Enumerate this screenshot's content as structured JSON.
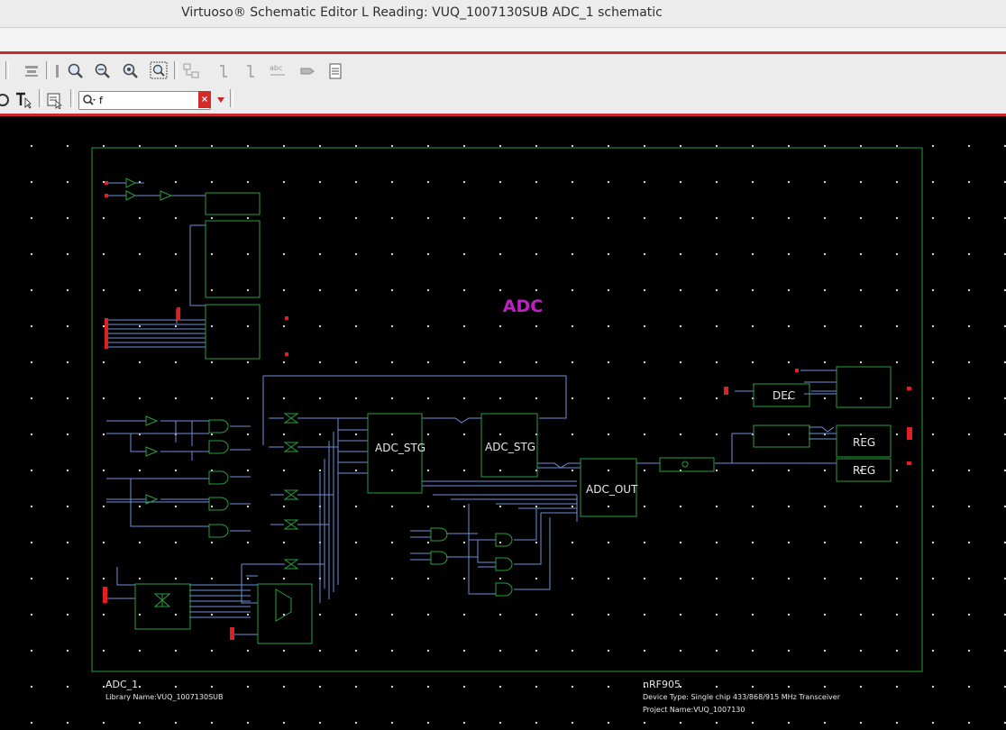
{
  "window": {
    "title": "Virtuoso® Schematic Editor L Reading: VUQ_1007130SUB ADC_1 schematic"
  },
  "toolbar": {
    "icons": [
      "align-icon",
      "distribute-icon",
      "zoom-fit-icon",
      "zoom-in-icon",
      "zoom-out-icon",
      "zoom-box-icon",
      "hierarchy-icon",
      "descend-icon",
      "return-icon",
      "label-icon",
      "pin-icon",
      "sheet-icon"
    ]
  },
  "search": {
    "value": "f",
    "clear_label": "×"
  },
  "schematic": {
    "title_label": "ADC",
    "colors": {
      "wire": "#6f8fd8",
      "outline": "#28a03c",
      "pin": "#e02020",
      "title": "#c21ec8",
      "text": "#e8e8e8"
    },
    "blocks": {
      "adc_stg_1": "ADC_STG",
      "adc_stg_2": "ADC_STG",
      "adc_out": "ADC_OUT",
      "dec": "DEC",
      "reg_1": "REG",
      "reg_2": "REG"
    },
    "titleblock": {
      "cell_name": "ADC_1",
      "library": "Library Name:VUQ_1007130SUB",
      "device_name": "nRF905",
      "device_type": "Device Type: Single chip 433/868/915 MHz Transceiver",
      "project": "Project Name:VUQ_1007130"
    }
  }
}
